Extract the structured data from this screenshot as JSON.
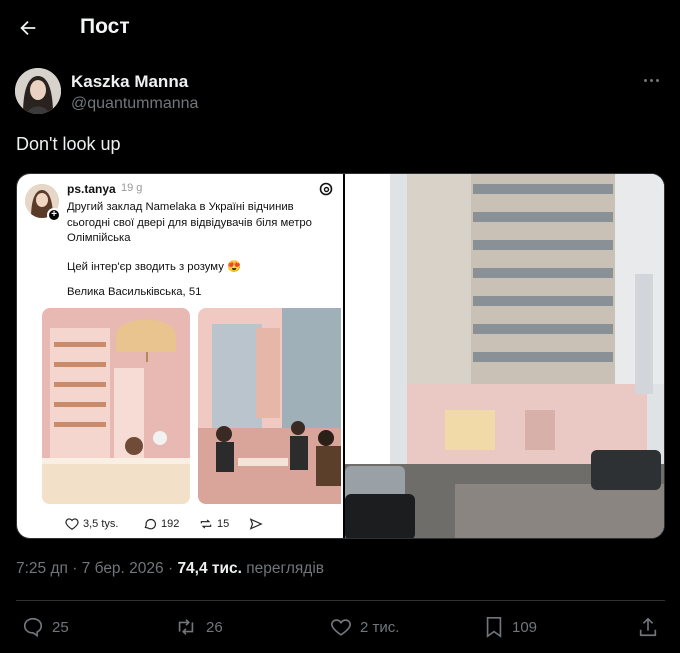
{
  "header": {
    "title": "Пост"
  },
  "author": {
    "name": "Kaszka Manna",
    "handle": "@quantummanna"
  },
  "post": {
    "text": "Don't look up"
  },
  "media": {
    "threads_card": {
      "username": "ps.tanya",
      "time": "19 g",
      "body": "Другий заклад Namelaka в Україні відчинив сьогодні свої двері для відвідувачів біля метро Олімпійська",
      "line2": "Цей інтер'єр зводить з розуму 😍",
      "line3": "Велика Васильківська, 51",
      "likes": "3,5 tys.",
      "comments": "192",
      "reposts": "15"
    }
  },
  "meta": {
    "time": "7:25 дп · 7 бер. 2026 · ",
    "views_count": "74,4 тис.",
    "views_label": " переглядів"
  },
  "actions": {
    "replies": "25",
    "reposts": "26",
    "likes": "2 тис.",
    "bookmarks": "109"
  },
  "colors": {
    "background": "#000000",
    "text": "#e7e9ea",
    "muted": "#71767b",
    "border": "#2f3336"
  }
}
